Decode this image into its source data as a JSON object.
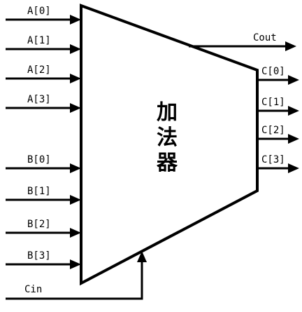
{
  "adder": {
    "title_chars": [
      "加",
      "法",
      "器"
    ]
  },
  "inputs_a": [
    "A[0]",
    "A[1]",
    "A[2]",
    "A[3]"
  ],
  "inputs_b": [
    "B[0]",
    "B[1]",
    "B[2]",
    "B[3]"
  ],
  "carry_in": "Cin",
  "carry_out": "Cout",
  "outputs_c": [
    "C[0]",
    "C[1]",
    "C[2]",
    "C[3]"
  ],
  "colors": {
    "line": "#000000",
    "background": "#ffffff"
  }
}
